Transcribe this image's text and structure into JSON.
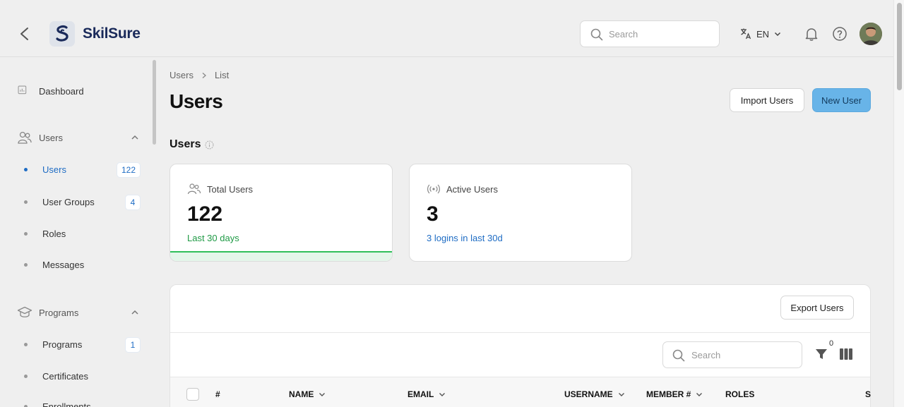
{
  "header": {
    "brand_name": "SkilSure",
    "search_placeholder": "Search",
    "language_code": "EN",
    "icons": [
      "chevron-left-icon",
      "translate-icon",
      "bell-icon",
      "help-icon"
    ]
  },
  "sidebar": {
    "dashboard_label": "Dashboard",
    "groups": [
      {
        "label": "Users",
        "items": [
          {
            "label": "Users",
            "badge": "122",
            "active": true
          },
          {
            "label": "User Groups",
            "badge": "4"
          },
          {
            "label": "Roles"
          },
          {
            "label": "Messages"
          }
        ]
      },
      {
        "label": "Programs",
        "items": [
          {
            "label": "Programs",
            "badge": "1"
          },
          {
            "label": "Certificates"
          },
          {
            "label": "Enrollments"
          }
        ]
      }
    ]
  },
  "breadcrumb": [
    "Users",
    "List"
  ],
  "page": {
    "title": "Users",
    "import_label": "Import Users",
    "new_label": "New User",
    "section_title": "Users"
  },
  "stats": [
    {
      "label": "Total Users",
      "value": "122",
      "sub": "Last 30 days",
      "color": "#1f9a45"
    },
    {
      "label": "Active Users",
      "value": "3",
      "sub": "3 logins in last 30d",
      "color": "#1e6cc4"
    }
  ],
  "table": {
    "export_label": "Export Users",
    "search_placeholder": "Search",
    "filter_count": "0",
    "columns": [
      "#",
      "NAME",
      "EMAIL",
      "USERNAME",
      "MEMBER #",
      "ROLES",
      "S"
    ]
  },
  "colors": {
    "accent": "#1e6cc4",
    "primary_button": "#68b4e8",
    "success": "#2fbf5a"
  }
}
